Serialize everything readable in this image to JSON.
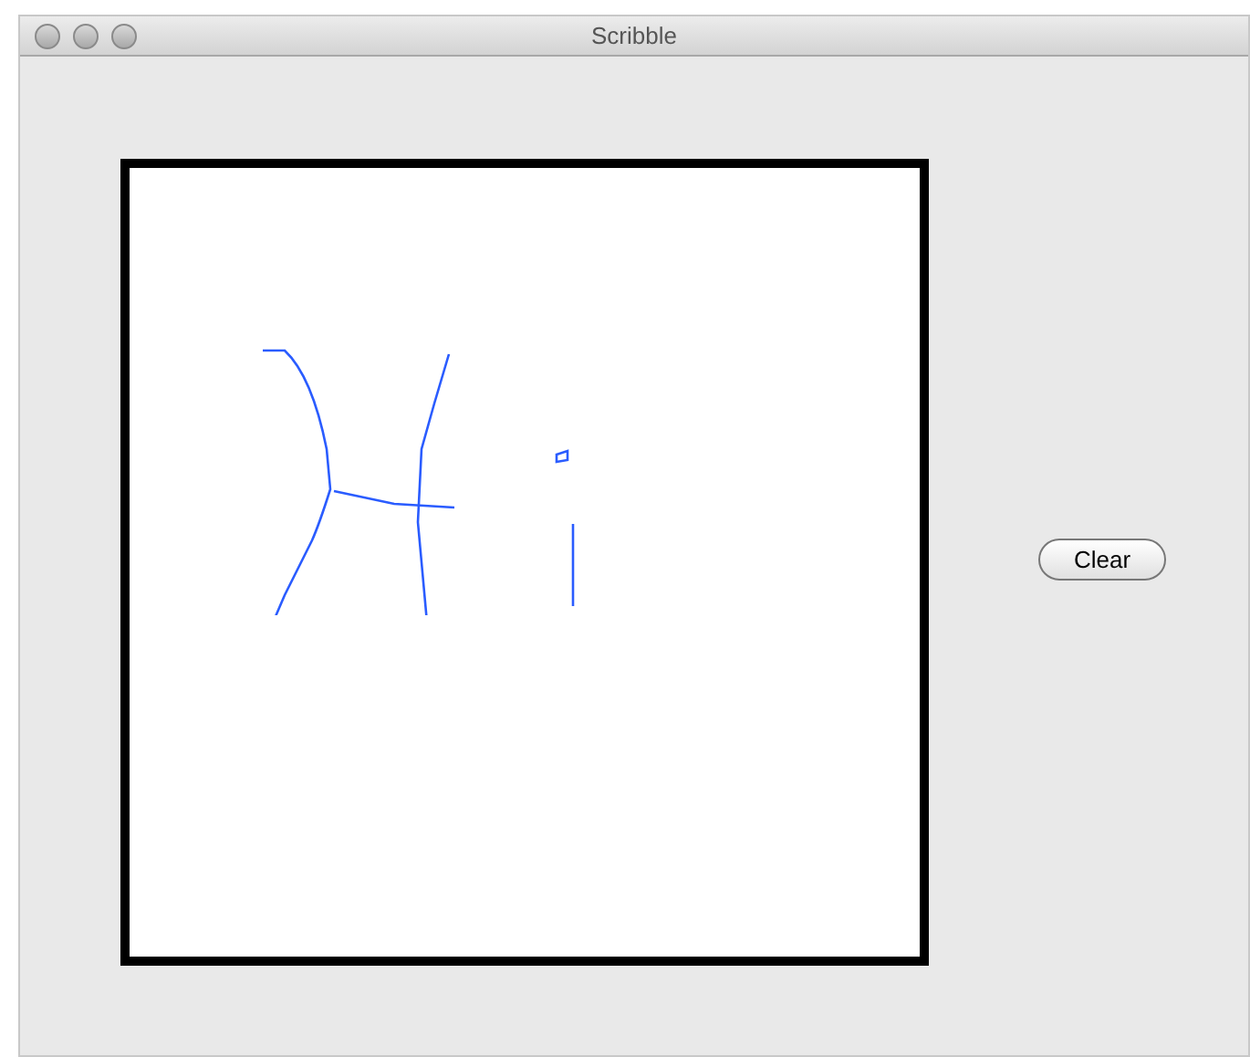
{
  "window": {
    "title": "Scribble"
  },
  "clear_button": {
    "label": "Clear"
  }
}
